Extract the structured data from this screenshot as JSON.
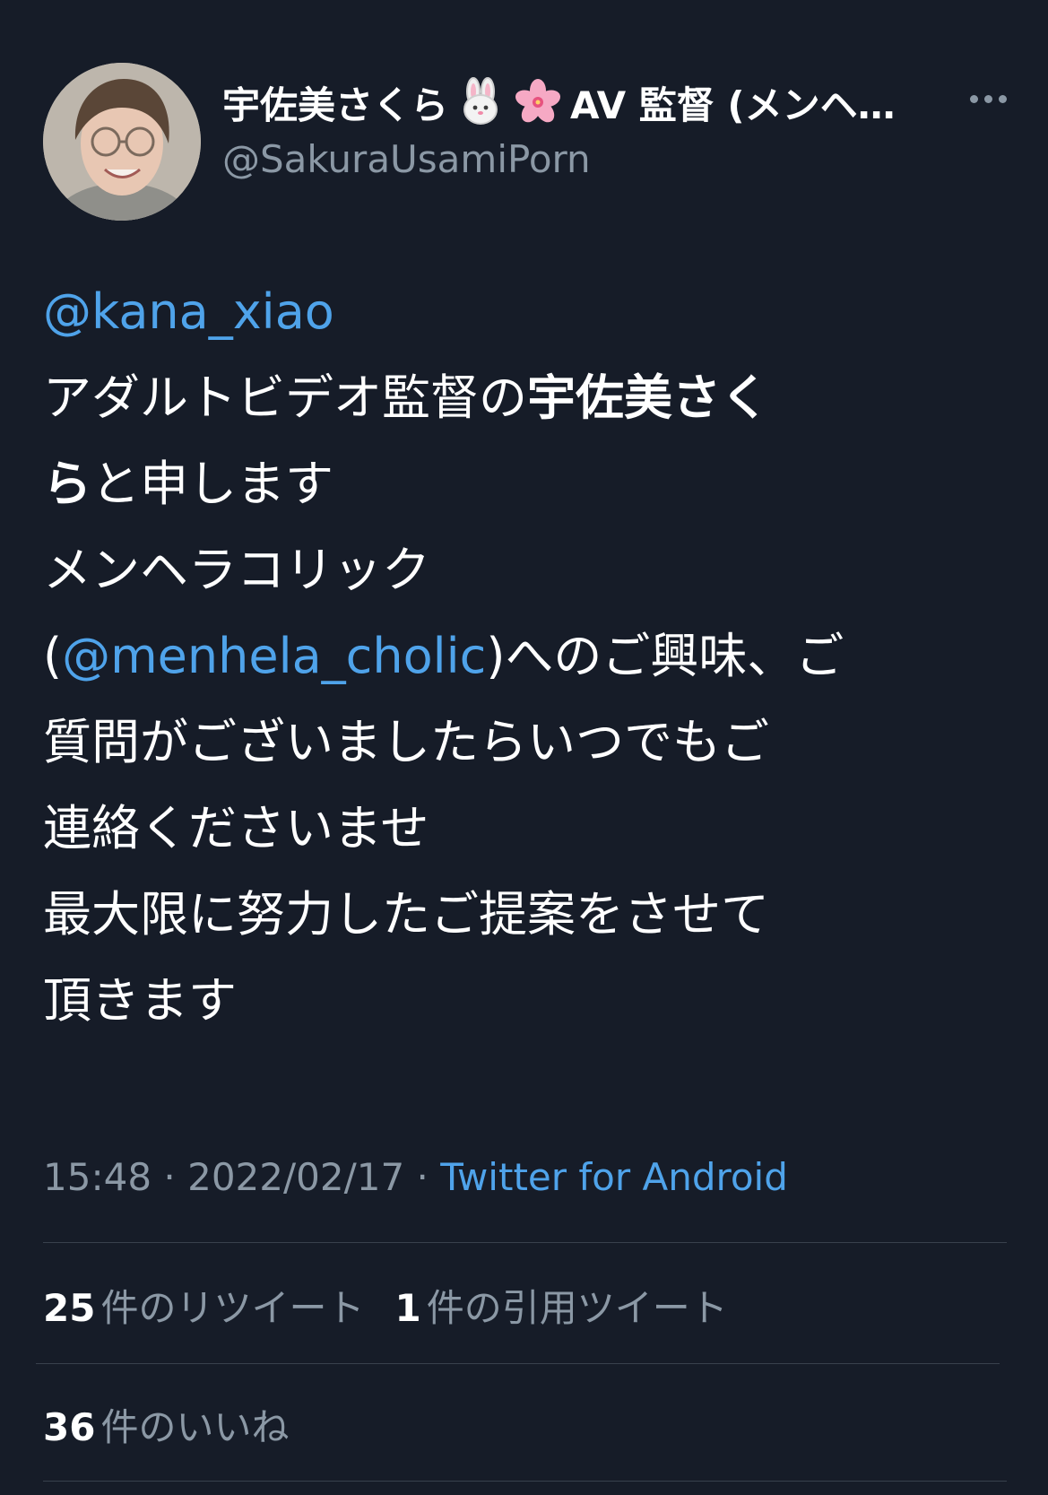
{
  "header": {
    "display_name": "宇佐美さくら",
    "display_name_suffix": "AV 監督 (メンヘ…",
    "handle": "@SakuraUsamiPorn"
  },
  "tweet": {
    "mention_1": "@kana_xiao",
    "line_1": "アダルトビデオ監督の",
    "line_1_bold": "宇佐美さく",
    "line_2_bold": "ら",
    "line_2": "と申します",
    "line_3": "メンヘラコリック",
    "line_4_open": "(",
    "mention_2": "@menhela_cholic",
    "line_4_close": ")",
    "line_4_rest": "へのご興味、ご",
    "line_5": "質問がございましたらいつでもご",
    "line_6": "連絡くださいませ",
    "line_7": "最大限に努力したご提案をさせて",
    "line_8": "頂きます"
  },
  "meta": {
    "time": "15:48",
    "separator": " · ",
    "date": "2022/02/17",
    "source": "Twitter for Android"
  },
  "stats": {
    "retweets_count": "25",
    "retweets_label": "件のリツイート",
    "quotes_count": "1",
    "quotes_label": "件の引用ツイート",
    "likes_count": "36",
    "likes_label": "件のいいね"
  },
  "icons": {
    "bunny": "rabbit-face-emoji",
    "flower": "cherry-blossom-emoji",
    "more": "more-options-icon"
  },
  "colors": {
    "background": "#161c28",
    "link": "#4fa3ea",
    "secondary_text": "#8b98a5",
    "divider": "#38414d"
  }
}
